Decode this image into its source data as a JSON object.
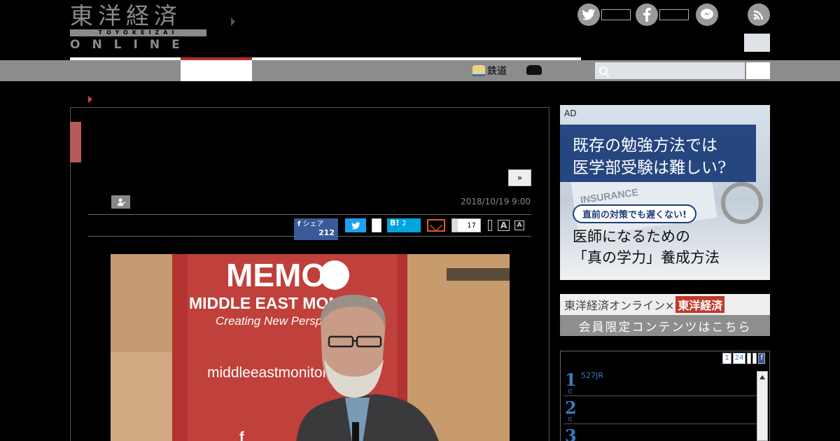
{
  "header": {
    "logo_top": "東洋経済",
    "logo_band": "TOYOKEIZAI",
    "logo_bottom": "ONLINE"
  },
  "nav": {
    "rail_label": "鉄道"
  },
  "article": {
    "date": "2018/10/19 9:00",
    "next_label": "»",
    "share": {
      "facebook_label": "シェア",
      "facebook_count": "212",
      "hatena_label": "B!",
      "hatena_count": "2",
      "bookmark_count": "17"
    },
    "font_large": "A",
    "font_small": "A",
    "photo": {
      "banner_title": "MEMO",
      "banner_subtitle": "MIDDLE EAST MONITOR",
      "banner_tagline": "Creating New Perspec",
      "banner_url": "middleeastmonitor",
      "banner_f": "f"
    }
  },
  "sidebar": {
    "ad": {
      "tag": "AD",
      "line1": "既存の勉強方法では",
      "line2": "医学部受験は難しい?",
      "pill": "直前の対策でも遅くない!",
      "line3": "医師になるための",
      "line4": "「真の学力」養成方法",
      "bg_text": "INSURANCE"
    },
    "member": {
      "top_text": "東洋経済オンライン×",
      "top_brand": "東洋経済",
      "bottom_text": "会員限定コンテンツはこちら"
    },
    "ranking": {
      "tabs": [
        "1",
        "24"
      ],
      "rows": [
        {
          "num": "1",
          "sub": "位",
          "title": "527JR"
        },
        {
          "num": "2",
          "sub": "位",
          "title": ""
        },
        {
          "num": "3",
          "sub": "",
          "title": ""
        }
      ]
    }
  },
  "colors": {
    "facebook": "#3b5998",
    "twitter": "#1da1f2",
    "hatena": "#00a4de",
    "accent_red": "#b85a5a",
    "ad_navy": "#1c3e7a"
  }
}
